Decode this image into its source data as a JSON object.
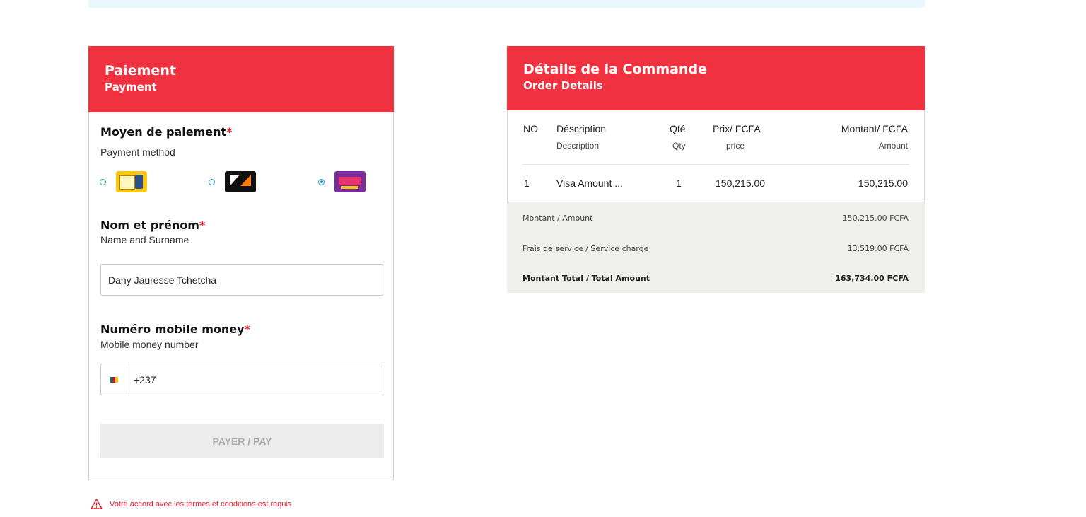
{
  "payment": {
    "title": "Paiement",
    "subtitle": "Payment",
    "method_title": "Moyen de paiement",
    "method_subtitle": "Payment method",
    "required_mark": "*",
    "methods": [
      {
        "icon": "mtn-mobile-money-logo",
        "selected": false
      },
      {
        "icon": "orange-money-logo",
        "selected": false
      },
      {
        "icon": "yoomee-money-logo",
        "selected": true
      }
    ],
    "name_title": "Nom et prénom",
    "name_subtitle": "Name and Surname",
    "name_value": "Dany Jauresse Tchetcha",
    "phone_title": "Numéro mobile money",
    "phone_subtitle": "Mobile money number",
    "phone_value": "+237",
    "flag_colors": [
      "#007a5e",
      "#ce1126",
      "#fcd116"
    ],
    "pay_label": "PAYER / PAY"
  },
  "warning": {
    "text": "Votre accord avec les termes et conditions est requis",
    "icon": "warning-triangle-icon"
  },
  "order": {
    "title": "Détails de la Commande",
    "subtitle": "Order Details",
    "columns": [
      {
        "main": "NO",
        "sub": ""
      },
      {
        "main": "Déscription",
        "sub": "Description"
      },
      {
        "main": "Qté",
        "sub": "Qty"
      },
      {
        "main": "Prix/ FCFA",
        "sub": "price"
      },
      {
        "main": "Montant/ FCFA",
        "sub": "Amount"
      }
    ],
    "rows": [
      {
        "no": "1",
        "description": "Visa Amount ...",
        "qty": "1",
        "price": "150,215.00",
        "amount": "150,215.00"
      }
    ],
    "totals": [
      {
        "label": "Montant / Amount",
        "value": "150,215.00 FCFA"
      },
      {
        "label": "Frais de service / Service charge",
        "value": "13,519.00 FCFA"
      },
      {
        "label": "Montant Total / Total Amount",
        "value": "163,734.00 FCFA"
      }
    ]
  },
  "colors": {
    "header_red": "#f03240",
    "required_red": "#e3212f",
    "radio_teal": "#1f9bb5",
    "banner": "#e8f6fd",
    "totals_bg": "#efefed"
  }
}
